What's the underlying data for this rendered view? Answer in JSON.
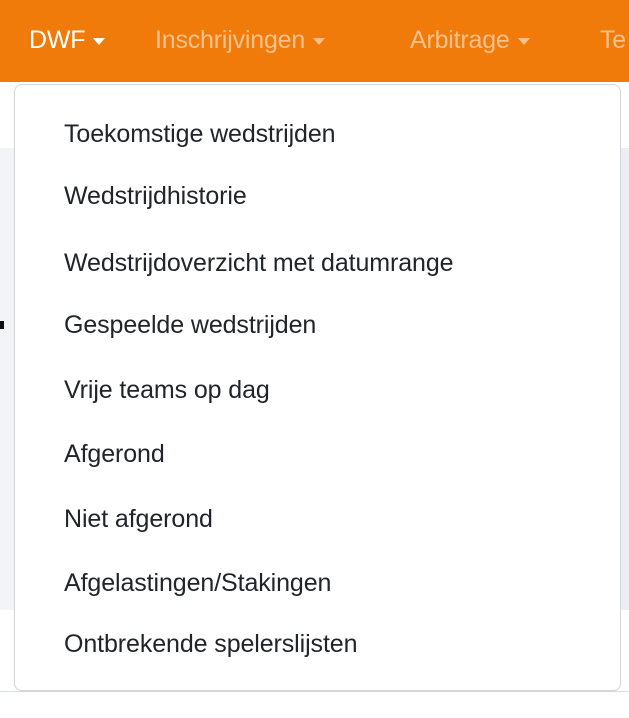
{
  "nav": {
    "items": [
      {
        "label": "DWF"
      },
      {
        "label": "Inschrijvingen"
      },
      {
        "label": "Arbitrage"
      },
      {
        "label": "Te"
      }
    ]
  },
  "dropdown": {
    "items": [
      {
        "label": "Toekomstige wedstrijden"
      },
      {
        "label": "Wedstrijdhistorie"
      },
      {
        "label": "Wedstrijdoverzicht met datumrange"
      },
      {
        "label": "Gespeelde wedstrijden"
      },
      {
        "label": "Vrije teams op dag"
      },
      {
        "label": "Afgerond"
      },
      {
        "label": "Niet afgerond"
      },
      {
        "label": "Afgelastingen/Stakingen"
      },
      {
        "label": "Ontbrekende spelerslijsten"
      }
    ]
  },
  "colors": {
    "navbar": "#f07b0b",
    "nav_active_text": "#ffffff",
    "nav_inactive_text": "#f8c18c",
    "menu_text": "#212529"
  }
}
